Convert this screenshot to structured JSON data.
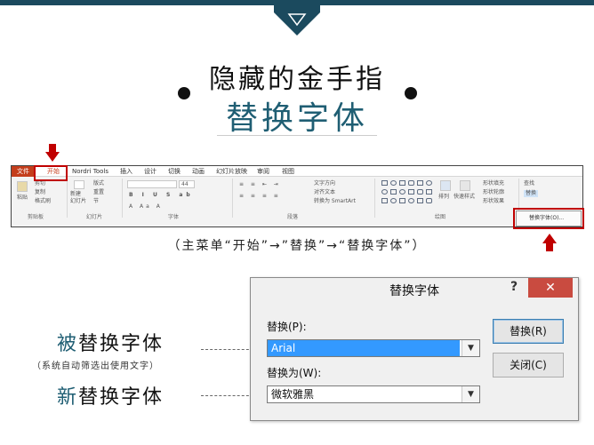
{
  "header": {
    "line1": "隐藏的金手指",
    "line2": "替换字体"
  },
  "ribbon": {
    "tabs": [
      "文件",
      "开始",
      "Nordri Tools",
      "插入",
      "设计",
      "切换",
      "动画",
      "幻灯片放映",
      "审阅",
      "视图"
    ],
    "clipboard": {
      "paste": "粘贴",
      "cut": "剪切",
      "copy": "复制",
      "format_painter": "格式刷",
      "group": "剪贴板"
    },
    "slides": {
      "new_slide": "新建\n幻灯片",
      "layout": "版式",
      "reset": "重置",
      "section": "节",
      "group": "幻灯片"
    },
    "font": {
      "size": "44",
      "group": "字体"
    },
    "paragraph": {
      "text_direction": "文字方向",
      "align_text": "对齐文本",
      "smartart": "转换为 SmartArt",
      "group": "段落"
    },
    "drawing": {
      "arrange": "排列",
      "quick_styles": "快速样式",
      "shape_fill": "形状填充",
      "shape_outline": "形状轮廓",
      "shape_effects": "形状效果",
      "group": "绘图"
    },
    "editing": {
      "find": "查找",
      "replace": "替换"
    },
    "menu_replace_fonts": "替换字体(O)..."
  },
  "caption": "（主菜单“开始”→”替换”→“替换字体”）",
  "labels": {
    "replaced_prefix": "被",
    "replaced_rest": "替换字体",
    "replaced_note": "（系统自动筛选出使用文字）",
    "new_prefix": "新",
    "new_rest": "替换字体"
  },
  "dialog": {
    "title": "替换字体",
    "help": "?",
    "close": "✕",
    "replace_label": "替换(P):",
    "replace_value": "Arial",
    "with_label": "替换为(W):",
    "with_value": "微软雅黑",
    "replace_button": "替换(R)",
    "close_button": "关闭(C)"
  },
  "colors": {
    "accent": "#1f5e73",
    "banner": "#1b4a5e",
    "highlight": "#c00000",
    "file_tab": "#c43e1c",
    "close_button": "#c94b40",
    "selection": "#3399ff"
  },
  "icons": [
    "chevron-down-icon",
    "arrow-down-icon",
    "arrow-up-icon",
    "close-icon",
    "help-icon",
    "find-icon",
    "replace-icon"
  ]
}
